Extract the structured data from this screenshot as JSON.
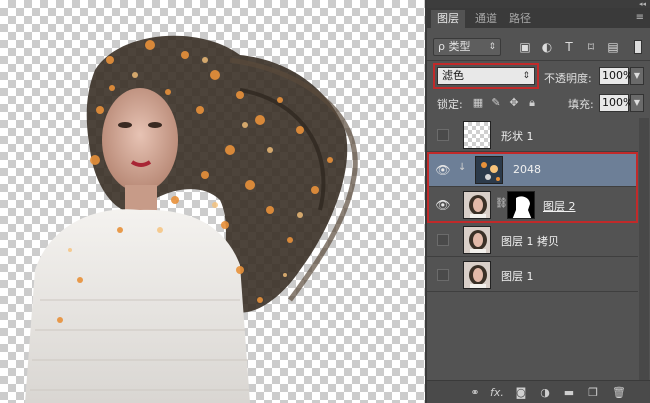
{
  "panel": {
    "tabs": [
      {
        "label": "图层",
        "active": true
      },
      {
        "label": "通道",
        "active": false
      },
      {
        "label": "路径",
        "active": false
      }
    ],
    "filter": {
      "kind_label": "ρ 类型",
      "icons": [
        "image-filter-icon",
        "adjustment-filter-icon",
        "type-filter-icon",
        "shape-filter-icon",
        "smart-object-filter-icon"
      ]
    },
    "blend_mode": "滤色",
    "opacity_label": "不透明度:",
    "opacity_value": "100%",
    "lock_label": "锁定:",
    "fill_label": "填充:",
    "fill_value": "100%",
    "accent_selected": "#6d7f97",
    "highlight_color": "#c12a2a"
  },
  "layers": [
    {
      "name": "形状 1",
      "visible": false,
      "selected": false,
      "thumb": "transparent"
    },
    {
      "name": "2048",
      "visible": true,
      "selected": true,
      "thumb": "smart"
    },
    {
      "name": "图层 2",
      "visible": true,
      "selected": false,
      "thumb": "portrait",
      "has_mask": true
    },
    {
      "name": "图层 1 拷贝",
      "visible": false,
      "selected": false,
      "thumb": "portrait"
    },
    {
      "name": "图层 1",
      "visible": false,
      "selected": false,
      "thumb": "portrait"
    }
  ],
  "bottom_bar": {
    "icons": [
      "link-layers-icon",
      "fx-icon",
      "add-mask-icon",
      "adjustment-layer-icon",
      "new-group-icon",
      "new-layer-icon",
      "delete-layer-icon"
    ],
    "fx_label": "fx."
  }
}
